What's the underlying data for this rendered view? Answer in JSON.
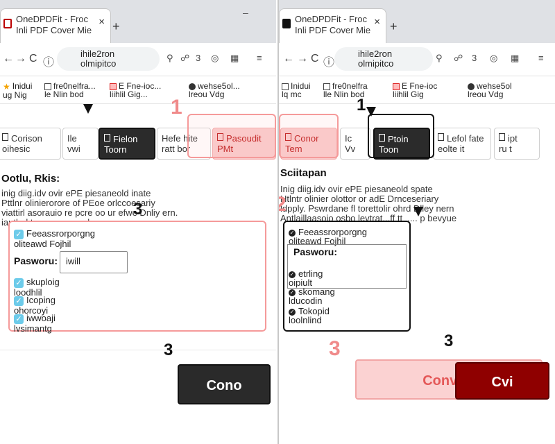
{
  "left": {
    "tab": {
      "title_line1": "OneDPDFit - Froc",
      "title_line2": "Inli PDF Cover Mie",
      "close": "×",
      "new_tab": "+"
    },
    "window": {
      "minimize": "–"
    },
    "nav": {
      "back": "←",
      "forward": "→",
      "reload": "C",
      "info": "ⓘ",
      "url_line1": "ihile2ron",
      "url_line2": "olmipitco",
      "icons": [
        "⚲",
        "☍",
        "3",
        "◎",
        "▦",
        "≡"
      ]
    },
    "bookmarks": [
      {
        "icon": "star",
        "line1": "Inidui",
        "line2": "ug Nig"
      },
      {
        "icon": "box",
        "line1": "fre0nelfra...",
        "line2": "le Nlin bod"
      },
      {
        "icon": "red",
        "line1": "E Fne-ioc...",
        "line2": "liihlil Gig..."
      },
      {
        "icon": "round",
        "line1": "wehse5ol...",
        "line2": "lreou Vdg"
      }
    ],
    "formats": [
      {
        "line1": "Corison",
        "line2": "oihesic"
      },
      {
        "line1": "Ile",
        "line2": "vwi"
      },
      {
        "line1": "Fielon",
        "line2": "Toorn"
      },
      {
        "line1": "Hefe hite",
        "line2": "ratt bor"
      },
      {
        "line1": "Pasoudit",
        "line2": "PMt"
      }
    ],
    "step1": "1",
    "step2": "3",
    "step3": "3",
    "desc": {
      "title": "Ootlu, Rkis:",
      "lines": [
        "inig diig.idv ovir ePE piesaneold inate",
        "Pttlnr olinierorore of PEoe orlccoesariy",
        "viattirl asorauio re pcre oo ur efwe Dnliy ern.",
        "iautlarl.tore o pseo pyle mg..m:v... pevyue"
      ]
    },
    "options": {
      "opt1": "Feeassrorporgng",
      "opt1b": "oliteawd Fojhil",
      "pw_label": "Pasworu:",
      "pw_value": "iwill",
      "opt2": "skuploig",
      "opt2b": "loodhlil",
      "opt3": "Icoping",
      "opt3b": "ohorcoyi",
      "opt4": "iwwoaji",
      "opt4b": "lvsimantg"
    },
    "convert": "Cono"
  },
  "right": {
    "tab": {
      "title_line1": "OneDPDFit - Froc",
      "title_line2": "Inli PDF Cover Mie",
      "close": "×",
      "new_tab": "+"
    },
    "nav": {
      "url_line1": "ihile2ron",
      "url_line2": "olmipitco"
    },
    "bookmarks": [
      {
        "icon": "box",
        "line1": "Inidui",
        "line2": "lq mc"
      },
      {
        "icon": "box",
        "line1": "fre0nelfra",
        "line2": "lle Nlin bod"
      },
      {
        "icon": "red",
        "line1": "E Fne-ioc",
        "line2": "liihlil Gig"
      },
      {
        "icon": "round",
        "line1": "wehse5ol",
        "line2": "lreou Vdg"
      }
    ],
    "formats": [
      {
        "line1": "Conor",
        "line2": "Tem"
      },
      {
        "line1": "Ic",
        "line2": "Vv"
      },
      {
        "line1": "Ptoin",
        "line2": "Toon"
      },
      {
        "line1": "Lefol fate",
        "line2": "eolte it"
      },
      {
        "line1": "ipt",
        "line2": "ru t"
      }
    ],
    "step1": "1",
    "step2": "2",
    "step3": "3",
    "desc": {
      "title": "Sciitapan",
      "lines": [
        "Inig diig.idv ovir ePE piesaneold spate",
        "Htlntr olinier olottor or adE Drnceseriary",
        "ldpply. Pswrdane fl torettolir ohrd Dlley nern",
        "Antlaillaasoio osbo levtrat...ff tt_.... p bevyue"
      ]
    },
    "options": {
      "opt1": "Feeassrorporgng",
      "opt1b": "oliteawd Fojhil",
      "pw_label": "Pasworu:",
      "opt2": "etrling",
      "opt2b": "oipiult",
      "opt3": "skomang",
      "opt3b": "lducodin",
      "opt4": "Tokopid",
      "opt4b": "loolnlind"
    },
    "convert_light": "Convert",
    "convert_red": "Cvi"
  }
}
